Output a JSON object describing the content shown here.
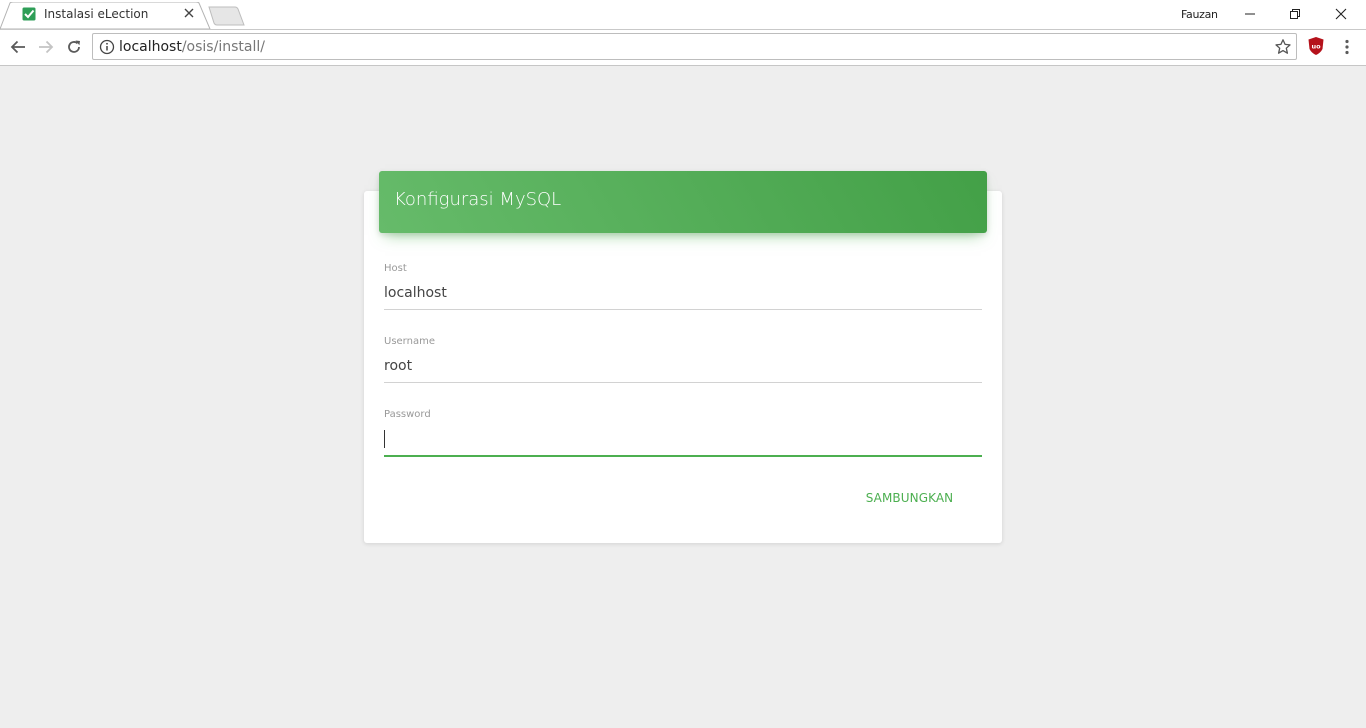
{
  "browser": {
    "tab_title": "Instalasi eLection",
    "profile_name": "Fauzan",
    "url_host": "localhost",
    "url_path": "/osis/install/"
  },
  "card": {
    "title": "Konfigurasi MySQL",
    "fields": [
      {
        "label": "Host",
        "value": "localhost"
      },
      {
        "label": "Username",
        "value": "root"
      },
      {
        "label": "Password",
        "value": ""
      }
    ],
    "submit_label": "SAMBUNGKAN"
  },
  "colors": {
    "accent_green": "#4caf50",
    "header_gradient_start": "#66bb6a",
    "header_gradient_end": "#43a047",
    "page_background": "#eeeeee"
  },
  "icons": [
    "check-square-icon",
    "close-icon",
    "back-icon",
    "forward-icon",
    "reload-icon",
    "info-icon",
    "star-icon",
    "ublock-icon",
    "more-vert-icon",
    "minimize-icon",
    "restore-icon",
    "window-close-icon"
  ]
}
